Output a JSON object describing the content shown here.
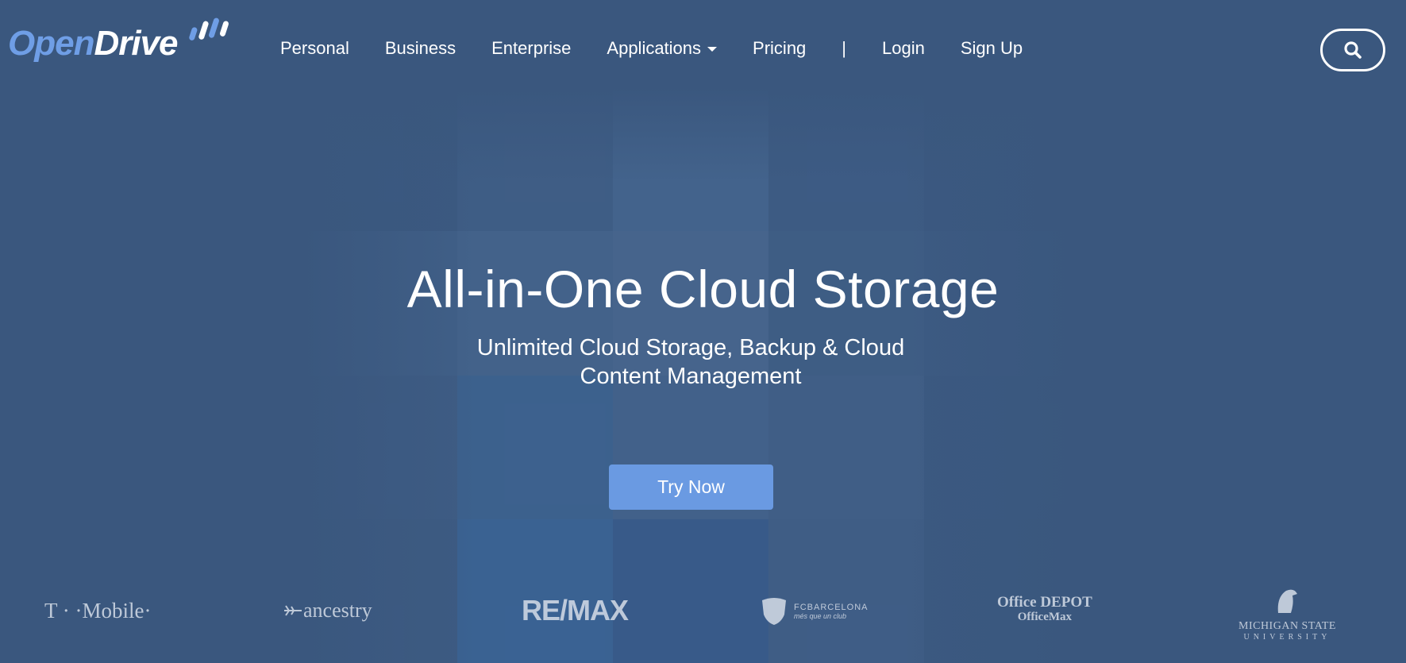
{
  "logo": {
    "part1": "Open",
    "part2": "Drive"
  },
  "nav": {
    "items": [
      {
        "label": "Personal"
      },
      {
        "label": "Business"
      },
      {
        "label": "Enterprise"
      },
      {
        "label": "Applications"
      },
      {
        "label": "Pricing"
      },
      {
        "label": "|"
      },
      {
        "label": "Login"
      },
      {
        "label": "Sign Up"
      }
    ]
  },
  "search": {
    "icon": "search-icon"
  },
  "hero": {
    "title": "All-in-One Cloud Storage",
    "subtitle": "Unlimited Cloud Storage, Backup & Cloud Content Management",
    "cta_label": "Try Now"
  },
  "brands": {
    "tmobile": "T · ·Mobile·",
    "ancestry": "ancestry",
    "remax": "RE/MAX",
    "fcb_name": "FCBARCELONA",
    "fcb_tag": "més que un club",
    "officedepot_1": "Office DEPOT",
    "officedepot_2": "OfficeMax",
    "msu_name": "MICHIGAN STATE",
    "msu_uni": "UNIVERSITY"
  },
  "colors": {
    "background": "#3a577e",
    "accent": "#6a9ae2",
    "logo_open": "#6f9ee6"
  }
}
